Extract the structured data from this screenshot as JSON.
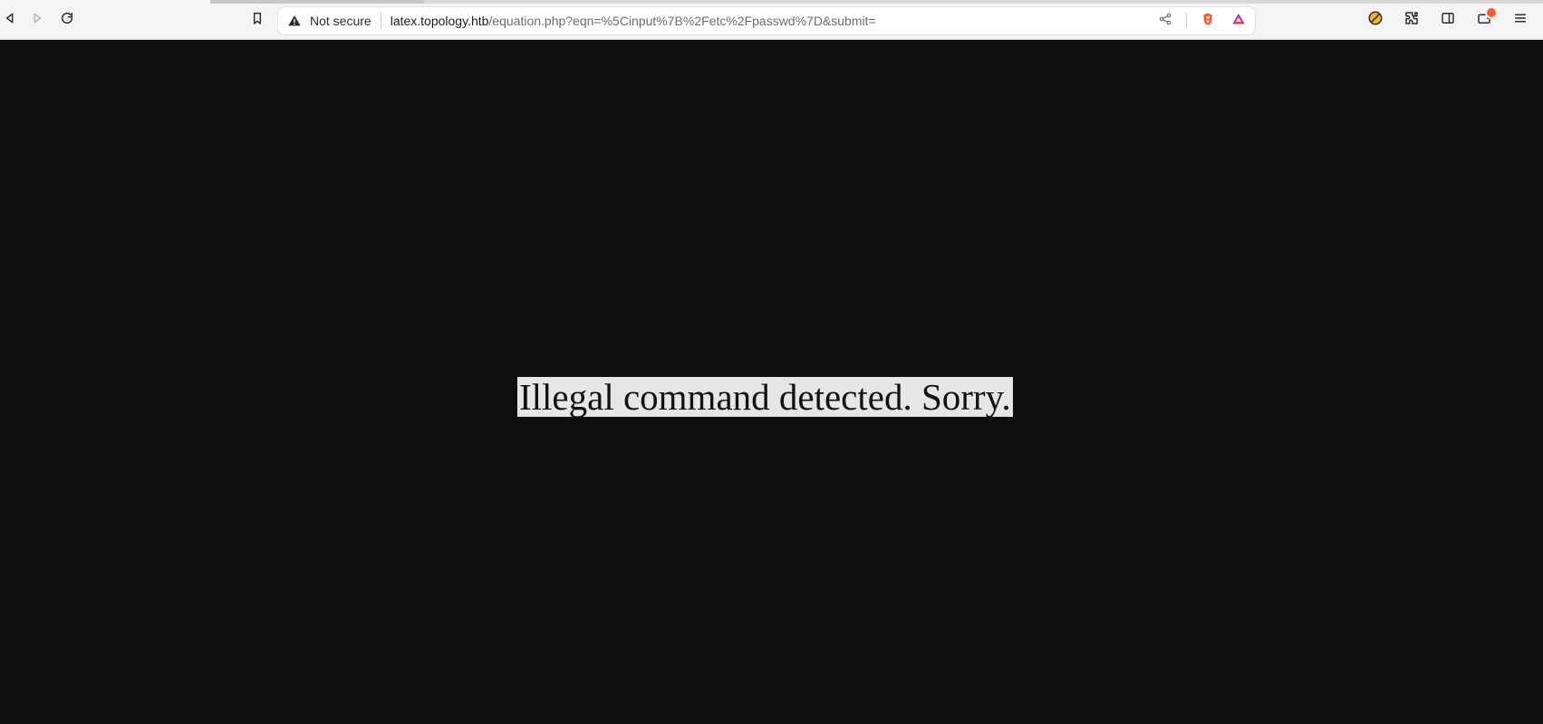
{
  "browser": {
    "security_label": "Not secure",
    "url_host": "latex.topology.htb",
    "url_path": "/equation.php?eqn=%5Cinput%7B%2Fetc%2Fpasswd%7D&submit=",
    "icons": {
      "back": "back-icon",
      "forward": "forward-icon",
      "reload": "reload-icon",
      "bookmark": "bookmark-icon",
      "warning": "warning-icon",
      "share": "share-icon",
      "brave": "brave-shields-icon",
      "rewards": "brave-rewards-icon",
      "blocked": "blocked-icon",
      "extensions": "puzzle-icon",
      "sidebar": "sidebar-icon",
      "wallet": "wallet-icon",
      "menu": "menu-icon"
    },
    "colors": {
      "toolbar_bg": "#f4f4f5",
      "urlbar_bg": "#ffffff",
      "content_bg": "#0f0f10",
      "message_bg": "#e6e6e6",
      "brave_orange": "#ff5a2a",
      "brave_purple": "#7b2cff"
    }
  },
  "page": {
    "message": "Illegal command detected. Sorry."
  }
}
